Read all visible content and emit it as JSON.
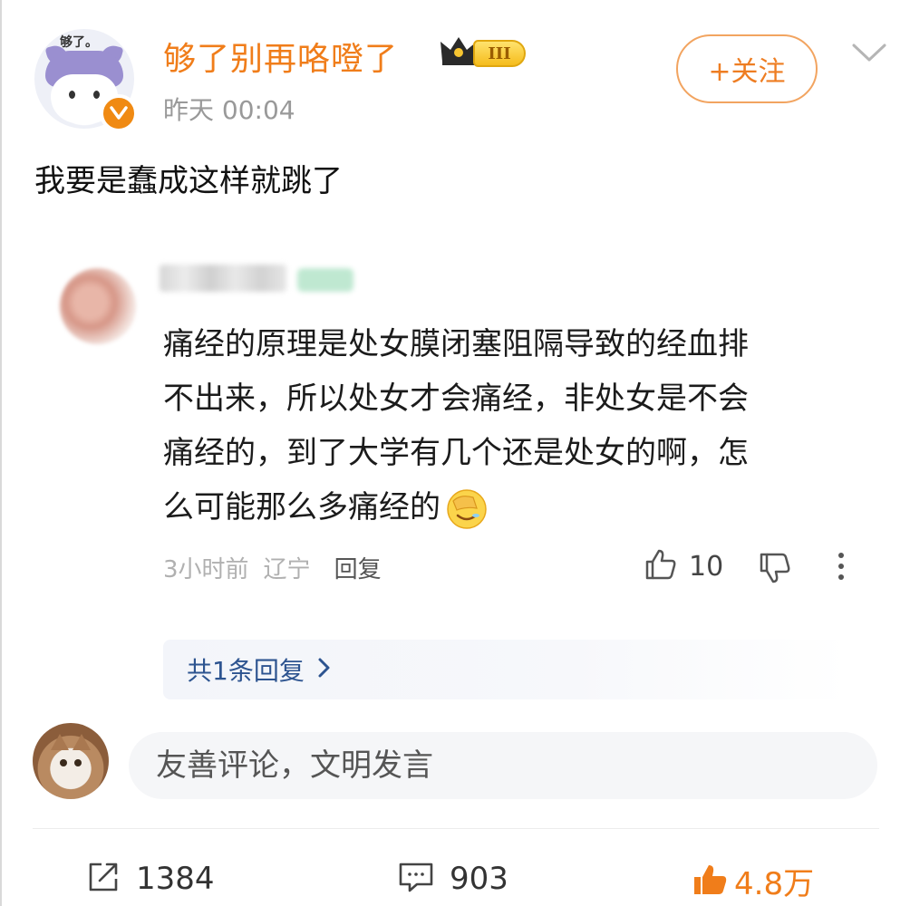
{
  "post": {
    "author": {
      "name": "够了别再咯噔了",
      "avatar_caption": "够了。",
      "rank_badge": "III",
      "verified_icon": "verified-badge-icon",
      "crown_icon": "crown-icon"
    },
    "time": "昨天 00:04",
    "follow_label": "+关注",
    "text": "我要是蠢成这样就跳了"
  },
  "reply": {
    "lines": [
      "痛经的原理是处女膜闭塞阻隔导致的经血排",
      "不出来，所以处女才会痛经，非处女是不会",
      "痛经的，到了大学有几个还是处女的啊，怎",
      "么可能那么多痛经的"
    ],
    "emoji": "facepalm-emoji",
    "time": "3小时前",
    "location": "辽宁",
    "reply_label": "回复",
    "like_count": "10",
    "replies_summary": "共1条回复"
  },
  "comment_box": {
    "placeholder": "友善评论，文明发言"
  },
  "action_bar": {
    "share_count": "1384",
    "comment_count": "903",
    "like_count": "4.8万"
  },
  "colors": {
    "username": "#f07d1a",
    "follow_border": "#f2a460",
    "link_blue": "#2d5490",
    "like_active": "#f07d1a",
    "muted_text": "#999999"
  }
}
